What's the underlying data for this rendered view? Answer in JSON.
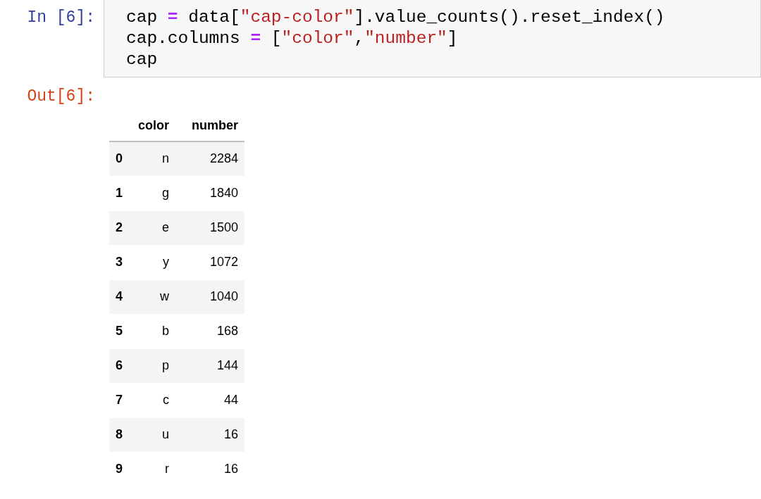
{
  "input_cell": {
    "prompt": "In [6]:",
    "lines": [
      [
        {
          "kind": "plain",
          "text": "cap "
        },
        {
          "kind": "operator",
          "text": "="
        },
        {
          "kind": "plain",
          "text": " data["
        },
        {
          "kind": "string",
          "text": "\"cap-color\""
        },
        {
          "kind": "plain",
          "text": "].value_counts().reset_index()"
        }
      ],
      [
        {
          "kind": "plain",
          "text": "cap.columns "
        },
        {
          "kind": "operator",
          "text": "="
        },
        {
          "kind": "plain",
          "text": " ["
        },
        {
          "kind": "string",
          "text": "\"color\""
        },
        {
          "kind": "plain",
          "text": ","
        },
        {
          "kind": "string",
          "text": "\"number\""
        },
        {
          "kind": "plain",
          "text": "]"
        }
      ],
      [
        {
          "kind": "plain",
          "text": "cap"
        }
      ]
    ]
  },
  "output_cell": {
    "prompt": "Out[6]:",
    "table": {
      "columns": [
        "color",
        "number"
      ],
      "rows": [
        {
          "index": "0",
          "cells": [
            "n",
            "2284"
          ]
        },
        {
          "index": "1",
          "cells": [
            "g",
            "1840"
          ]
        },
        {
          "index": "2",
          "cells": [
            "e",
            "1500"
          ]
        },
        {
          "index": "3",
          "cells": [
            "y",
            "1072"
          ]
        },
        {
          "index": "4",
          "cells": [
            "w",
            "1040"
          ]
        },
        {
          "index": "5",
          "cells": [
            "b",
            "168"
          ]
        },
        {
          "index": "6",
          "cells": [
            "p",
            "144"
          ]
        },
        {
          "index": "7",
          "cells": [
            "c",
            "44"
          ]
        },
        {
          "index": "8",
          "cells": [
            "u",
            "16"
          ]
        },
        {
          "index": "9",
          "cells": [
            "r",
            "16"
          ]
        }
      ]
    }
  }
}
